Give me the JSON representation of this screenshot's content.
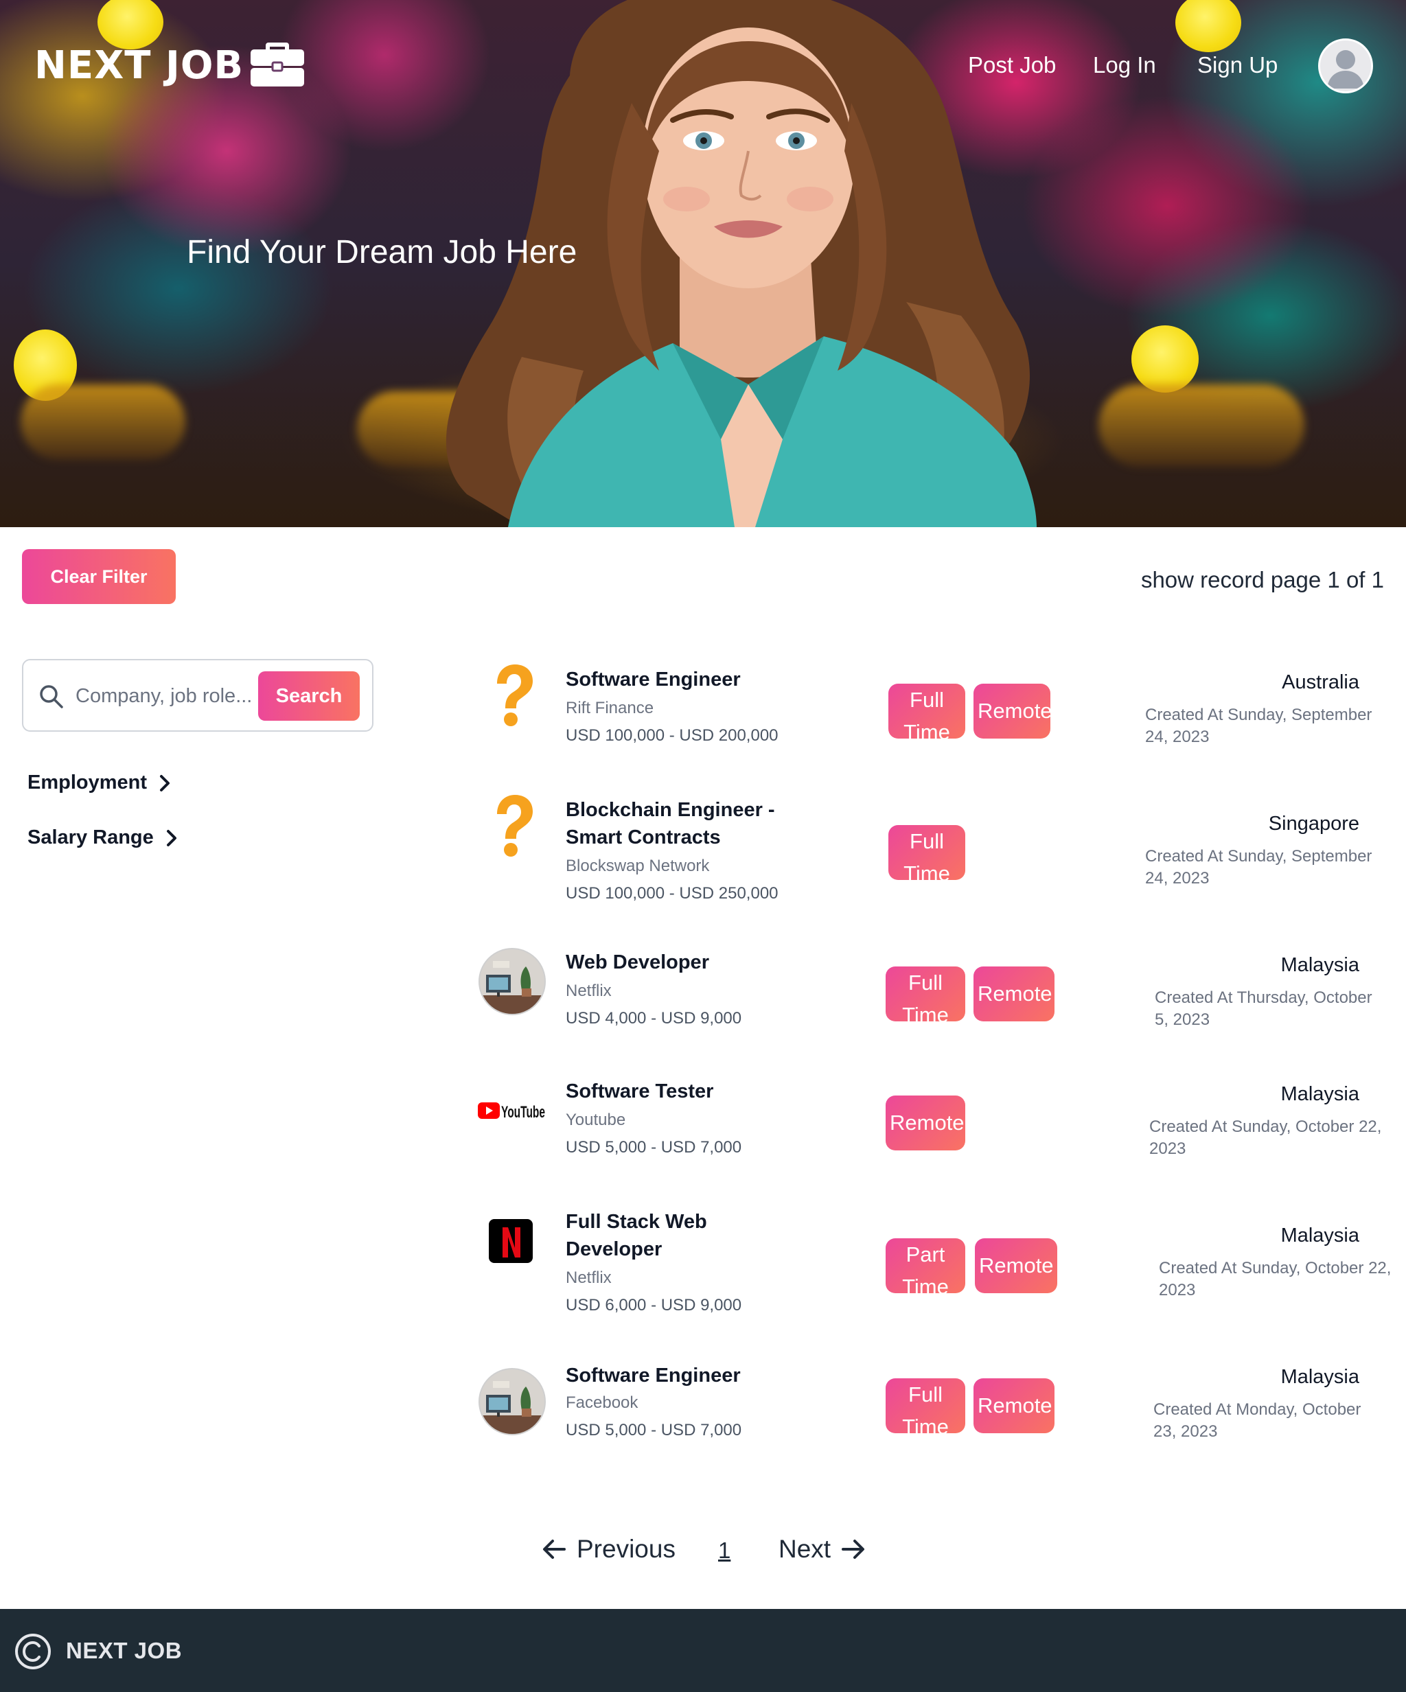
{
  "brand": {
    "name": "NEXT JOB"
  },
  "nav": {
    "post_job": "Post Job",
    "log_in": "Log In",
    "sign_up": "Sign Up"
  },
  "hero": {
    "title": "Find Your Dream Job Here"
  },
  "toolbar": {
    "clear_filter": "Clear Filter",
    "record_info": "show record page 1 of 1"
  },
  "search": {
    "placeholder": "Company, job role...",
    "button": "Search"
  },
  "filters": [
    {
      "label": "Employment"
    },
    {
      "label": "Salary Range"
    }
  ],
  "jobs": [
    {
      "title": "Software Engineer",
      "company": "Rift Finance",
      "salary": "USD 100,000 - USD 200,000",
      "tags": [
        "Full Time",
        "Remote"
      ],
      "location": "Australia",
      "created": "Created At Sunday, September 24, 2023",
      "logo": "question-mark-icon"
    },
    {
      "title": "Blockchain Engineer - Smart Contracts",
      "company": "Blockswap Network",
      "salary": "USD 100,000 - USD 250,000",
      "tags": [
        "Full Time"
      ],
      "location": "Singapore",
      "created": "Created At Sunday, September 24, 2023",
      "logo": "question-mark-icon"
    },
    {
      "title": "Web Developer",
      "company": "Netflix",
      "salary": "USD 4,000 - USD 9,000",
      "tags": [
        "Full Time",
        "Remote"
      ],
      "location": "Malaysia",
      "created": "Created At Thursday, October 5, 2023",
      "logo": "desk-photo"
    },
    {
      "title": "Software Tester",
      "company": "Youtube",
      "salary": "USD 5,000 - USD 7,000",
      "tags": [
        "Remote"
      ],
      "location": "Malaysia",
      "created": "Created At Sunday, October 22, 2023",
      "logo": "youtube-logo"
    },
    {
      "title": "Full Stack Web Developer",
      "company": "Netflix",
      "salary": "USD 6,000 - USD 9,000",
      "tags": [
        "Part Time",
        "Remote"
      ],
      "location": "Malaysia",
      "created": "Created At Sunday, October 22, 2023",
      "logo": "netflix-logo",
      "youtube_wordmark": "YouTube"
    },
    {
      "title": "Software Engineer",
      "company": "Facebook",
      "salary": "USD 5,000 - USD 7,000",
      "tags": [
        "Full Time",
        "Remote"
      ],
      "location": "Malaysia",
      "created": "Created At Monday, October 23, 2023",
      "logo": "desk-photo"
    }
  ],
  "logos": {
    "youtube_wordmark": "YouTube",
    "netflix_letter": "N"
  },
  "pagination": {
    "previous": "Previous",
    "current": "1",
    "next": "Next"
  },
  "footer": {
    "text": "NEXT JOB",
    "copyright_symbol": "C"
  },
  "colors": {
    "accent_start": "#ec4899",
    "accent_end": "#f97362",
    "footer_bg": "#1f2c35"
  }
}
